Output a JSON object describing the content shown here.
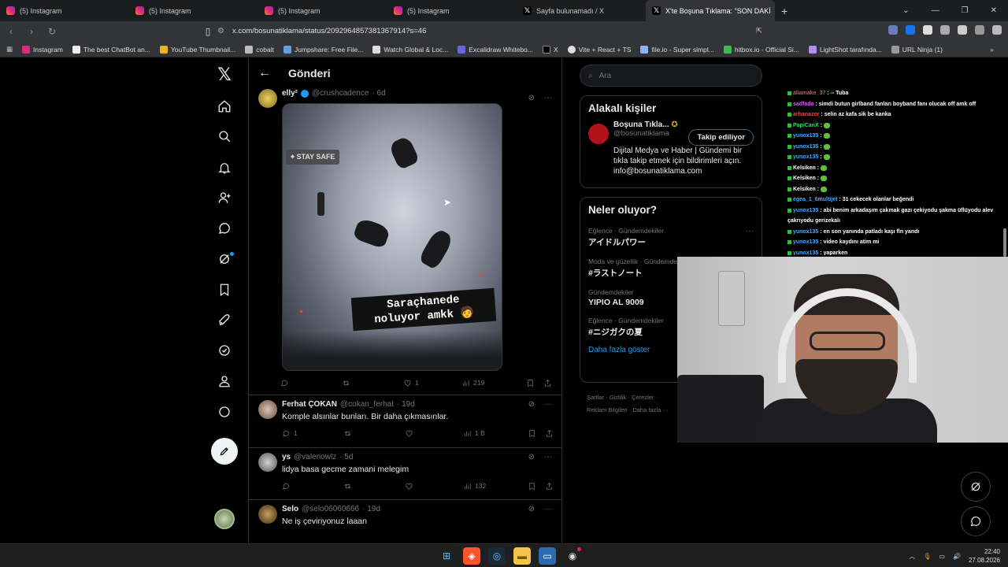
{
  "browser": {
    "tabs": [
      {
        "label": "(5) Instagram",
        "icon": "instagram"
      },
      {
        "label": "(5) Instagram",
        "icon": "instagram"
      },
      {
        "label": "(5) Instagram",
        "icon": "instagram"
      },
      {
        "label": "(5) Instagram",
        "icon": "instagram"
      },
      {
        "label": "Sayfa bulunamadı / X",
        "icon": "x"
      },
      {
        "label": "X'te Boşuna Tıklama: \"SON DAKİ",
        "icon": "x"
      }
    ],
    "url": "x.com/bosunatiklama/status/2092964857381367914?s=46",
    "bookmarks": [
      "Instagram",
      "The best ChatBot an...",
      "YouTube Thumbnail...",
      "cobalt",
      "Jumpshare: Free File...",
      "Watch Global & Loc...",
      "Excalidraw Whitebo...",
      "X",
      "Vite + React + TS",
      "file.io - Super simpl...",
      "hitbox.io - Official Si...",
      "LightShot tarafında...",
      "URL Ninja (1)"
    ]
  },
  "header": {
    "title": "Gönderi",
    "back": "←"
  },
  "tweets": [
    {
      "name": "elly²",
      "handle": "@crushcadence",
      "time": "· 6d",
      "media_badge": "STAY SAFE",
      "media_caption_1": "Saraçhanede",
      "media_caption_2": "noluyor amkk",
      "likes": "1",
      "views": "219"
    },
    {
      "name": "Ferhat ÇOKAN",
      "handle": "@cokan_ferhat",
      "time": "· 19d",
      "text": "Komple alsınlar bunları. Bir daha çıkmasınlar.",
      "replies": "1",
      "views": "1 B"
    },
    {
      "name": "ys",
      "handle": "@valeriowlz",
      "time": "· 5d",
      "text": "lidya basa gecme zamani melegim",
      "views": "132"
    },
    {
      "name": "Selo",
      "handle": "@selo06060666",
      "time": "· 19d",
      "text": "Ne iş çeviriyonuz laaan"
    }
  ],
  "search": {
    "placeholder": "Ara"
  },
  "related": {
    "title": "Alakalı kişiler",
    "name": "Boşuna Tıkla...",
    "handle": "@bosunatiklama",
    "follow_label": "Takip ediliyor",
    "bio": "Dijital Medya ve Haber | Gündemi bir tıkla takip etmek için bildirimleri açın. info@bosunatiklama.com"
  },
  "trends": {
    "title": "Neler oluyor?",
    "items": [
      {
        "context": "Eğlence · Gündemdekiler",
        "name": "アイドルパワー"
      },
      {
        "context": "Moda ve güzellik · Gündemde",
        "name": "#ラストノート"
      },
      {
        "context": "Gündemdekiler",
        "name": "YIPIO AL 9009"
      },
      {
        "context": "Eğlence · Gündemdekiler",
        "name": "#ニジガクの夏"
      }
    ],
    "show_more": "Daha fazla göster"
  },
  "footer": {
    "line1": "Şartlar · Gizlilik · Çerezler ·",
    "line2": "Reklam Bilgileri · Daha fazla ···"
  },
  "chat": [
    {
      "user": "aliamake_37",
      "text": ": -- Tuba",
      "color": "#e64b4b"
    },
    {
      "user": "sadfada",
      "text": ": simdi butun girlband fanları boyband fanı olucak off amk off",
      "color": "#d65cf0"
    },
    {
      "user": "arhanazor",
      "text": ": selin az kafa sik be kanka",
      "color": "#e64b4b"
    },
    {
      "user": "PapiCanX",
      "text": ":",
      "color": "#3ad66b"
    },
    {
      "user": "yunox135",
      "text": ":",
      "color": "#4aa8ff"
    },
    {
      "user": "yunox135",
      "text": ":",
      "color": "#4aa8ff"
    },
    {
      "user": "yunox135",
      "text": ":",
      "color": "#4aa8ff"
    },
    {
      "user": "Kelsiken",
      "text": ":",
      "color": "#ffffff"
    },
    {
      "user": "Kelsiken",
      "text": ":",
      "color": "#ffffff"
    },
    {
      "user": "Kelsiken",
      "text": ":",
      "color": "#ffffff"
    },
    {
      "user": "egea_1_6multijet",
      "text": ": 31 cekecek olanlar beğendi",
      "color": "#4aa8ff"
    },
    {
      "user": "yunox135",
      "text": ": abi benim arkadaşım çakmak gazı çekiyodu şakma üflüyodu alev",
      "color": "#4aa8ff"
    },
    {
      "user": "",
      "text": "çakrıyodu gerizekalı",
      "color": "#ffffff"
    },
    {
      "user": "yunox135",
      "text": ": en son yanında patladı kaşı fln yandı",
      "color": "#4aa8ff"
    },
    {
      "user": "yunox135",
      "text": ": video kaydını atim mi",
      "color": "#4aa8ff"
    },
    {
      "user": "yunox135",
      "text": ": yaparken",
      "color": "#4aa8ff"
    }
  ],
  "taskbar": {
    "time": "22:40",
    "date": "27.08.2026"
  }
}
